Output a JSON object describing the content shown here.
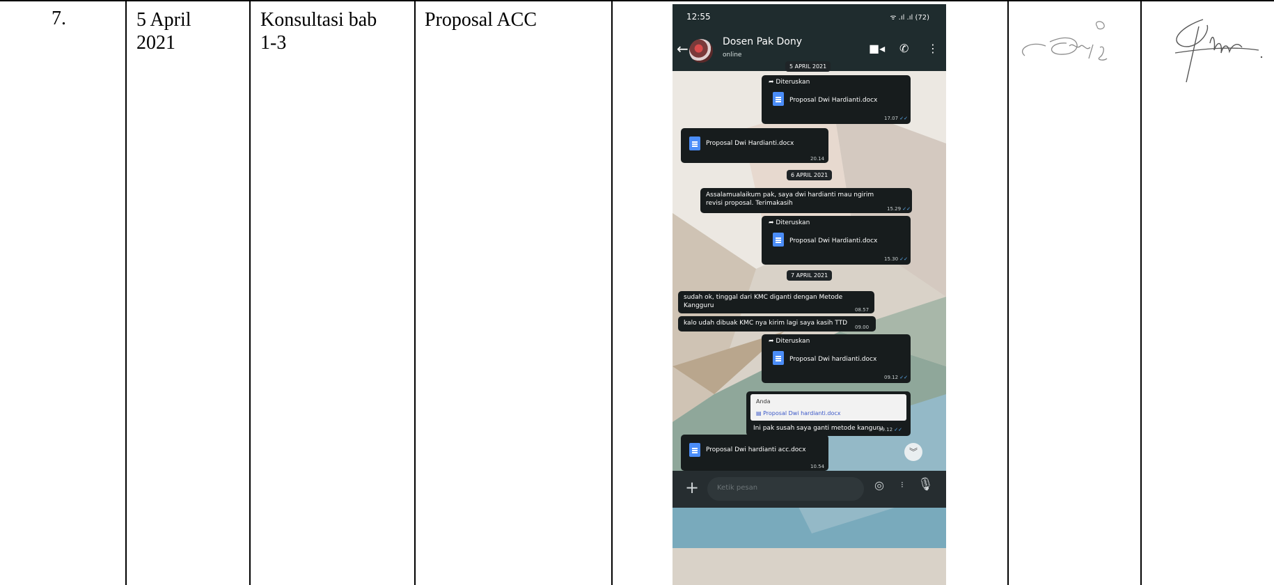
{
  "row": {
    "no": "7.",
    "date": "5 April\n2021",
    "topic": "Konsultasi bab\n1-3",
    "result": "Proposal ACC"
  },
  "phone": {
    "status_time": "12:55",
    "status_icons": "ᯤ .ıl .ıl (72)",
    "contact_name": "Dosen Pak Dony",
    "contact_status": "online",
    "forwarded_label": "Diteruskan",
    "dates": [
      "5 APRIL 2021",
      "6 APRIL 2021",
      "7 APRIL 2021"
    ],
    "files": {
      "f1": "Proposal Dwi Hardianti.docx",
      "f2": "Proposal Dwi Hardianti.docx",
      "f3": "Proposal Dwi Hardianti.docx",
      "f4": "Proposal Dwi hardianti.docx",
      "f5": "Proposal Dwi hardianti acc.docx"
    },
    "times": {
      "t1": "17.07",
      "t2": "20.14",
      "t3": "15.29",
      "t4": "15.30",
      "t5": "08.57",
      "t6": "09.00",
      "t7": "09.12",
      "t8": "09.12",
      "t9": "10.54"
    },
    "messages": {
      "m1": "Assalamualaikum pak, saya dwi hardianti mau ngirim revisi proposal. Terimakasih",
      "m2": "sudah ok, tinggal dari KMC diganti dengan Metode Kangguru",
      "m3": "kalo udah dibuak KMC nya kirim lagi saya kasih TTD",
      "m4": "Ini pak susah saya ganti metode kanguru"
    },
    "quote_author": "Anda",
    "quote_file": "Proposal Dwi hardianti.docx",
    "input_placeholder": "Ketik pesan"
  },
  "icons": {
    "back": "back-arrow-icon",
    "video": "video-call-icon",
    "call": "phone-call-icon",
    "menu": "more-vert-icon",
    "forward": "forward-arrow-icon",
    "document": "document-icon",
    "read": "double-check-icon",
    "scroll": "chevron-double-down-icon",
    "attach": "plus-icon",
    "camera": "camera-icon",
    "mic": "microphone-icon"
  },
  "colors": {
    "header": "#1f2c2e",
    "bubble": "#171c1d",
    "doc_icon": "#4b8df8",
    "read_tick": "#5fb3f9"
  }
}
